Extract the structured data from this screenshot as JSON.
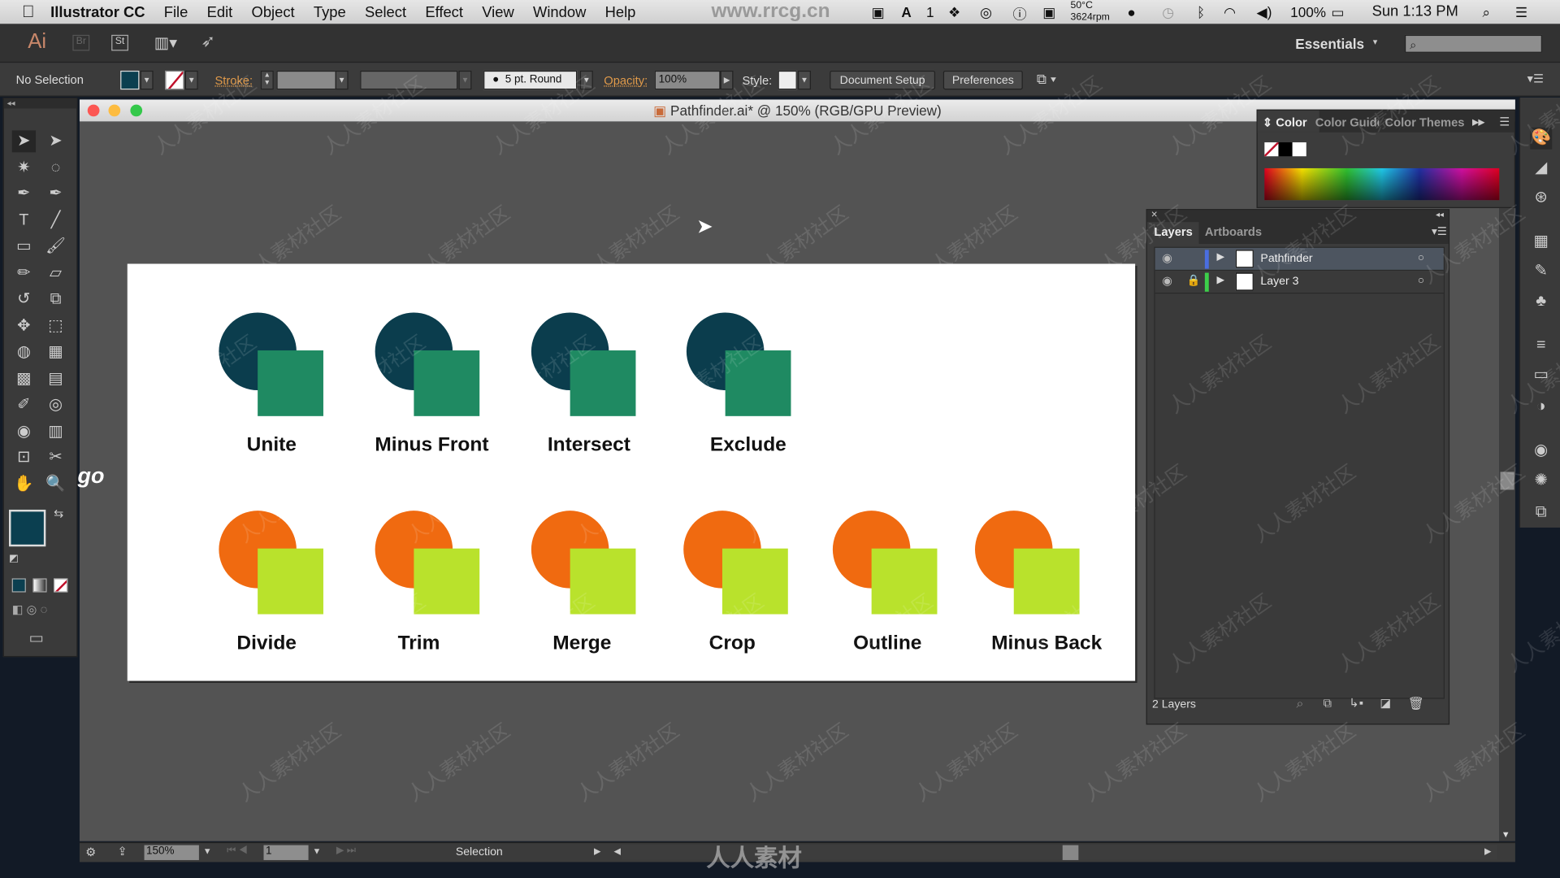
{
  "menubar": {
    "app": "Illustrator CC",
    "items": [
      "File",
      "Edit",
      "Object",
      "Type",
      "Select",
      "Effect",
      "View",
      "Window",
      "Help"
    ],
    "status": {
      "adobe_count": "1",
      "temp": "50°C",
      "fan": "3624rpm",
      "battery": "100%",
      "clock": "Sun 1:13 PM"
    }
  },
  "appbar": {
    "logo": "Ai",
    "bridge": "Br",
    "stock": "St",
    "workspace": "Essentials",
    "search_placeholder": ""
  },
  "control": {
    "selection": "No Selection",
    "stroke_label": "Stroke:",
    "brush": "5 pt. Round",
    "opacity_label": "Opacity:",
    "opacity": "100%",
    "style_label": "Style:",
    "doc_setup": "Document Setup",
    "preferences": "Preferences"
  },
  "document": {
    "title": "Pathfinder.ai* @ 150% (RGB/GPU Preview)"
  },
  "colors": {
    "fill": "#0b3f50",
    "circle_dark": "#0b3d4d",
    "square_green": "#1f8a62",
    "circle_orange": "#f06a10",
    "square_lime": "#b9e22c"
  },
  "artboard": {
    "row1": [
      "Unite",
      "Minus Front",
      "Intersect",
      "Exclude"
    ],
    "row2": [
      "Divide",
      "Trim",
      "Merge",
      "Crop",
      "Outline",
      "Minus Back"
    ]
  },
  "color_panel": {
    "tabs": [
      "Color",
      "Color Guide",
      "Color Themes"
    ]
  },
  "layers_panel": {
    "tabs": [
      "Layers",
      "Artboards"
    ],
    "layers": [
      {
        "name": "Pathfinder",
        "color": "#4a6ee0",
        "locked": false,
        "selected": true
      },
      {
        "name": "Layer 3",
        "color": "#3ccf4a",
        "locked": true,
        "selected": false
      }
    ],
    "count": "2 Layers"
  },
  "statusbar": {
    "zoom": "150%",
    "artboard": "1",
    "tool": "Selection"
  },
  "watermark": {
    "url": "www.rrcg.cn",
    "brand": "人人素材",
    "pattern": "人人素材社区"
  }
}
